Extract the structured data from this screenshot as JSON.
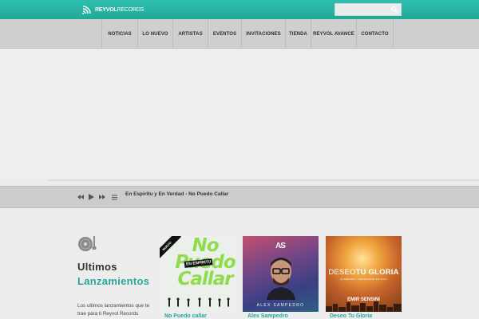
{
  "header": {
    "logo_bold": "REYVOL",
    "logo_light": "RECORDS",
    "search_placeholder": "",
    "accent_color": "#27b3a1"
  },
  "nav": {
    "items": [
      {
        "label": "NOTICIAS"
      },
      {
        "label": "LO NUEVO"
      },
      {
        "label": "ARTISTAS"
      },
      {
        "label": "EVENTOS"
      },
      {
        "label": "INVITACIONES"
      },
      {
        "label": "TIENDA"
      },
      {
        "label": "REYVOL AVANCE"
      },
      {
        "label": "CONTACTO"
      }
    ]
  },
  "player": {
    "now_playing": "En Espiritu y En Verdad - No Puedo Callar",
    "controls": [
      "prev-icon",
      "play-icon",
      "next-icon",
      "playlist-icon"
    ]
  },
  "releases": {
    "title_line1": "Ultimos",
    "title_line2": "Lanzamientos",
    "description": "Los ultimos lanzamientos que te trae para ti Reyvol Records",
    "albums": [
      {
        "caption": "No Puedo callar",
        "art_ribbon": "NUEVO",
        "art_title": "No Puedo Callar",
        "art_tag": "EN ESPÍRITU"
      },
      {
        "caption": "Alex Sampedro",
        "art_logo": "AS",
        "art_name": "ALEX SAMPEDRO"
      },
      {
        "caption": "Deseo Tu Gloria",
        "art_title_light": "DESEO",
        "art_title_bold": "TU GLORIA",
        "art_subtitle": "ALABANZA Y ADORACIÓN EN VIVO",
        "art_artist": "EMIR SENSINI"
      }
    ]
  }
}
